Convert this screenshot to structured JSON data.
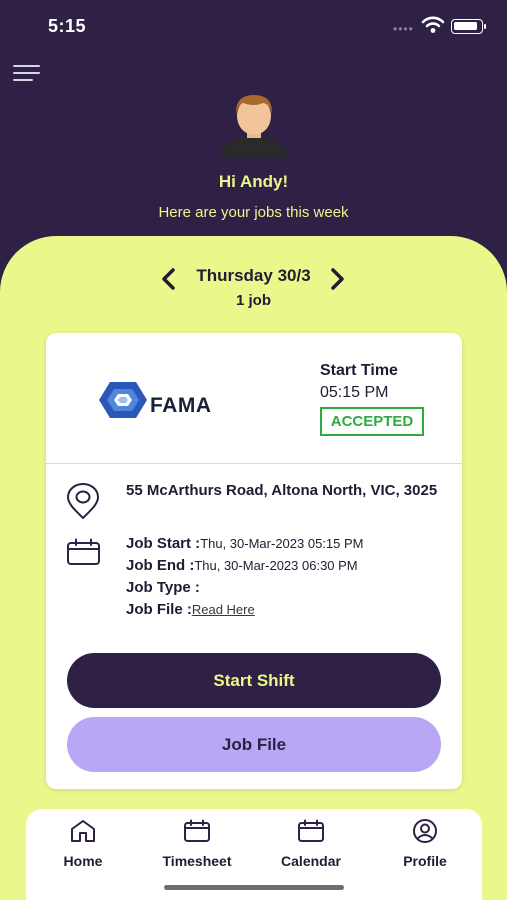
{
  "status_bar": {
    "time": "5:15",
    "signal_icon": "signal-dots-icon",
    "wifi_icon": "wifi-icon",
    "battery_icon": "battery-icon"
  },
  "header": {
    "menu_icon": "hamburger-menu-icon",
    "avatar_icon": "user-avatar-icon",
    "greeting": "Hi Andy!",
    "subtitle": "Here are your jobs this week",
    "background_color": "#2e2145",
    "accent_color": "#eaf78a"
  },
  "day_nav": {
    "prev_icon": "chevron-left-icon",
    "next_icon": "chevron-right-icon",
    "day_label": "Thursday 30/3",
    "job_count": "1 job"
  },
  "job_card": {
    "company_logo_icon": "fama-hexagon-logo",
    "company_name": "FAMA",
    "start_time_label": "Start Time",
    "start_time_value": "05:15 PM",
    "status": "ACCEPTED",
    "status_color": "#2faa3e",
    "location_icon": "location-pin-icon",
    "address": "55 McArthurs Road,  Altona North, VIC,  3025",
    "calendar_icon": "calendar-icon",
    "job_start_label": "Job Start :",
    "job_start_value": "Thu, 30-Mar-2023 05:15 PM",
    "job_end_label": "Job End :",
    "job_end_value": "Thu, 30-Mar-2023 06:30 PM",
    "job_type_label": "Job Type :",
    "job_type_value": "",
    "job_file_label": "Job File :",
    "job_file_link": "Read Here",
    "start_shift_button": "Start Shift",
    "job_file_button": "Job File",
    "start_button_color": "#2e2145",
    "file_button_color": "#b9a6f4"
  },
  "tab_bar": {
    "items": [
      {
        "label": "Home",
        "icon": "home-icon"
      },
      {
        "label": "Timesheet",
        "icon": "timesheet-icon"
      },
      {
        "label": "Calendar",
        "icon": "calendar-icon"
      },
      {
        "label": "Profile",
        "icon": "profile-icon"
      }
    ]
  }
}
